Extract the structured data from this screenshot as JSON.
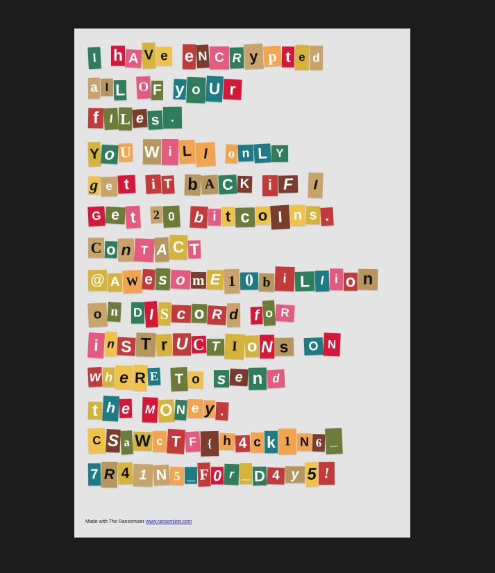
{
  "palette": [
    "#c23b3b",
    "#d6b33a",
    "#6d7b3a",
    "#b4965e",
    "#f1a551",
    "#2f7d5c",
    "#1f7b83",
    "#d4183a",
    "#e35b7f",
    "#7a3d2b",
    "#c9a46a",
    "#efc24b"
  ],
  "lines": [
    "I hAVe eNCRypted",
    "aIL OF yoUr",
    "fILes.",
    "YoU WiLl onLY",
    "get iT bACK iF I",
    "Get 20 bitcoIns.",
    "ConTACT",
    "@AWesomE10biLlion",
    "on DIScoRd foR",
    "inSTrUCTIoNs ON",
    "wheRE To send",
    "the MONey.",
    "CSaWcTF{h4ck1N6_",
    "7R41N5_F0r_D4y5!"
  ],
  "footer": {
    "prefix": "Made with The Ransomizer ",
    "link": "www.ransomizer.com"
  }
}
